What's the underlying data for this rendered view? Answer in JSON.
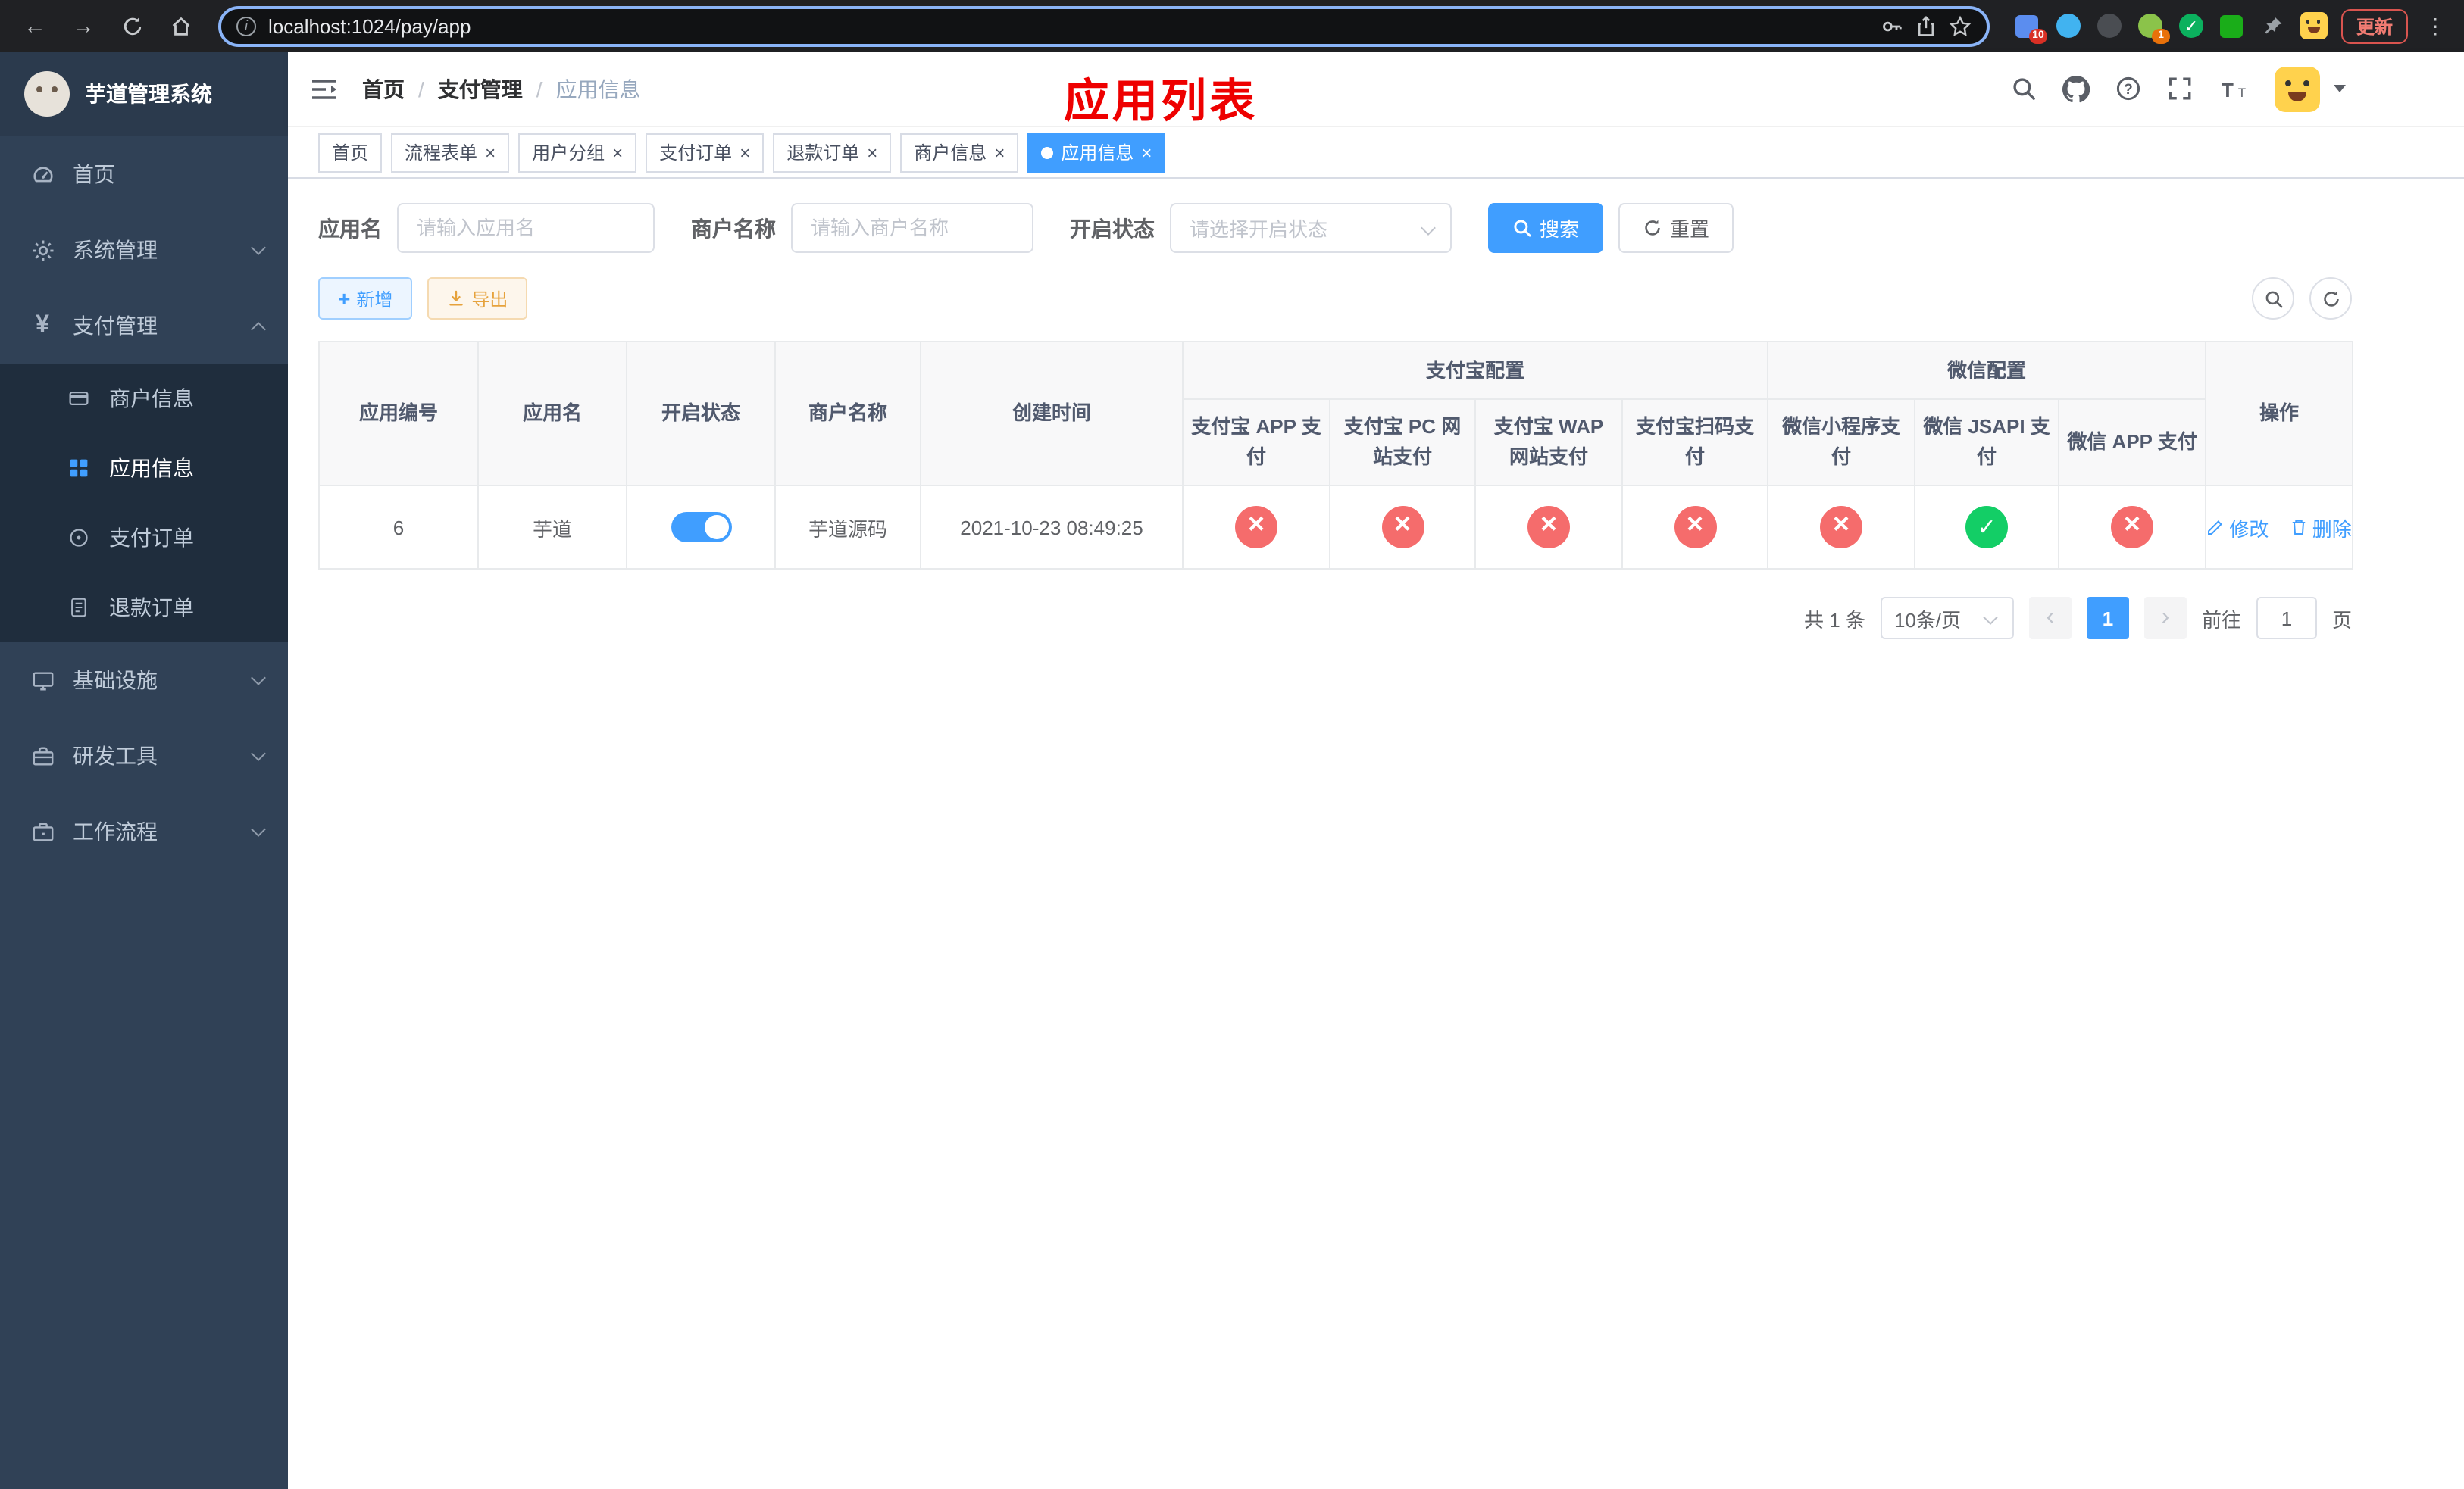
{
  "browser": {
    "url": "localhost:1024/pay/app",
    "update_button": "更新",
    "ext_badge_1": "10",
    "ext_badge_2": "1",
    "menu_icon": "⋮"
  },
  "sidebar": {
    "app_title": "芋道管理系统",
    "menu": [
      {
        "label": "首页"
      },
      {
        "label": "系统管理"
      },
      {
        "label": "支付管理"
      },
      {
        "label": "基础设施"
      },
      {
        "label": "研发工具"
      },
      {
        "label": "工作流程"
      }
    ],
    "pay_submenu": [
      {
        "label": "商户信息"
      },
      {
        "label": "应用信息"
      },
      {
        "label": "支付订单"
      },
      {
        "label": "退款订单"
      }
    ]
  },
  "header": {
    "breadcrumb": [
      {
        "label": "首页"
      },
      {
        "label": "支付管理"
      },
      {
        "label": "应用信息"
      }
    ],
    "separator": "/",
    "overlay_title": "应用列表"
  },
  "tabs": [
    {
      "label": "首页"
    },
    {
      "label": "流程表单"
    },
    {
      "label": "用户分组"
    },
    {
      "label": "支付订单"
    },
    {
      "label": "退款订单"
    },
    {
      "label": "商户信息"
    },
    {
      "label": "应用信息"
    }
  ],
  "filters": {
    "app_name_label": "应用名",
    "app_name_placeholder": "请输入应用名",
    "merchant_label": "商户名称",
    "merchant_placeholder": "请输入商户名称",
    "status_label": "开启状态",
    "status_placeholder": "请选择开启状态",
    "search_button": "搜索",
    "reset_button": "重置"
  },
  "toolbar": {
    "add_button": "新增",
    "export_button": "导出"
  },
  "table": {
    "groups": {
      "alipay": "支付宝配置",
      "wechat": "微信配置"
    },
    "columns": {
      "id": "应用编号",
      "name": "应用名",
      "status": "开启状态",
      "merchant": "商户名称",
      "created": "创建时间",
      "alipay_app": "支付宝 APP 支付",
      "alipay_pc": "支付宝 PC 网站支付",
      "alipay_wap": "支付宝 WAP 网站支付",
      "alipay_qr": "支付宝扫码支付",
      "wx_mini": "微信小程序支付",
      "wx_jsapi": "微信 JSAPI 支付",
      "wx_app": "微信 APP 支付",
      "actions": "操作"
    },
    "edit_label": "修改",
    "delete_label": "删除",
    "rows": [
      {
        "id": "6",
        "name": "芋道",
        "enabled": true,
        "merchant": "芋道源码",
        "created": "2021-10-23 08:49:25",
        "alipay_app": false,
        "alipay_pc": false,
        "alipay_wap": false,
        "alipay_qr": false,
        "wx_mini": false,
        "wx_jsapi": true,
        "wx_app": false
      }
    ]
  },
  "pagination": {
    "total": "共 1 条",
    "page_size": "10条/页",
    "page": "1",
    "goto_prefix": "前往",
    "goto_value": "1",
    "goto_suffix": "页"
  }
}
